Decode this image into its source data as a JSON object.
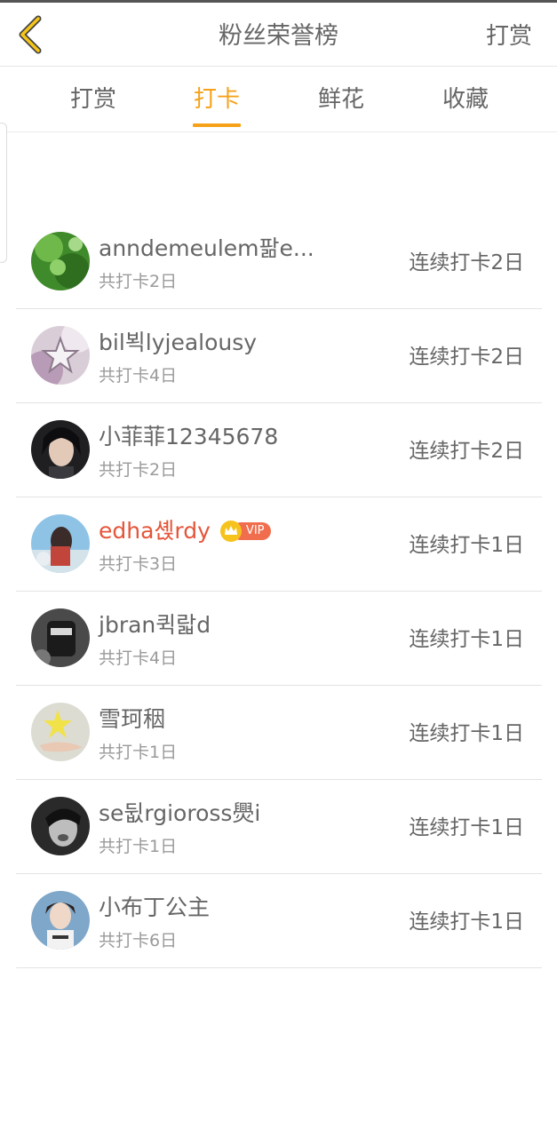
{
  "header": {
    "title": "粉丝荣誉榜",
    "action_label": "打赏",
    "back_icon": "chevron-left-icon",
    "accent_color": "#f5a21a"
  },
  "tabs": [
    {
      "label": "打赏",
      "active": false
    },
    {
      "label": "打卡",
      "active": true
    },
    {
      "label": "鲜花",
      "active": false
    },
    {
      "label": "收藏",
      "active": false
    }
  ],
  "fans": [
    {
      "name": "anndemeulem팖e...",
      "total": "共打卡2日",
      "streak": "连续打卡2日",
      "vip": false
    },
    {
      "name": "bil뵉lyjealousy",
      "total": "共打卡4日",
      "streak": "连续打卡2日",
      "vip": false
    },
    {
      "name": "小菲菲12345678",
      "total": "共打卡2日",
      "streak": "连续打卡2日",
      "vip": false
    },
    {
      "name": "edha셵rdy",
      "total": "共打卡3日",
      "streak": "连续打卡1日",
      "vip": true,
      "vip_label": "VIP"
    },
    {
      "name": "jbran퀵랇d",
      "total": "共打卡4日",
      "streak": "连续打卡1日",
      "vip": false
    },
    {
      "name": "雪珂秵",
      "total": "共打卡1日",
      "streak": "连续打卡1日",
      "vip": false
    },
    {
      "name": "se뒶rgioross爂i",
      "total": "共打卡1日",
      "streak": "连续打卡1日",
      "vip": false
    },
    {
      "name": "小布丁公主",
      "total": "共打卡6日",
      "streak": "连续打卡1日",
      "vip": false
    }
  ]
}
